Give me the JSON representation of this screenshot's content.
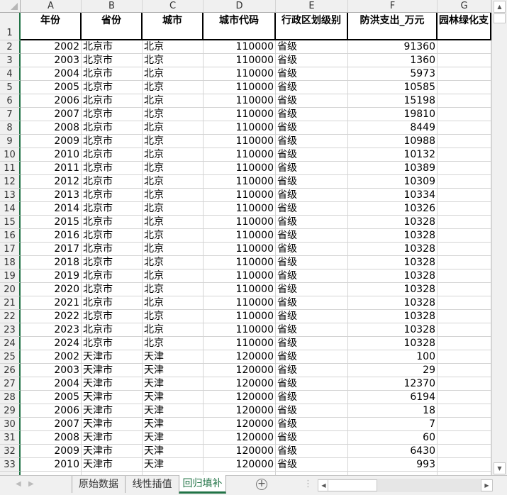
{
  "columns": [
    "A",
    "B",
    "C",
    "D",
    "E",
    "F",
    "G"
  ],
  "headers": [
    "年份",
    "省份",
    "城市",
    "城市代码",
    "行政区划级别",
    "防洪支出_万元",
    "园林绿化支"
  ],
  "rows": [
    [
      "2002",
      "北京市",
      "北京",
      "110000",
      "省级",
      "91360"
    ],
    [
      "2003",
      "北京市",
      "北京",
      "110000",
      "省级",
      "1360"
    ],
    [
      "2004",
      "北京市",
      "北京",
      "110000",
      "省级",
      "5973"
    ],
    [
      "2005",
      "北京市",
      "北京",
      "110000",
      "省级",
      "10585"
    ],
    [
      "2006",
      "北京市",
      "北京",
      "110000",
      "省级",
      "15198"
    ],
    [
      "2007",
      "北京市",
      "北京",
      "110000",
      "省级",
      "19810"
    ],
    [
      "2008",
      "北京市",
      "北京",
      "110000",
      "省级",
      "8449"
    ],
    [
      "2009",
      "北京市",
      "北京",
      "110000",
      "省级",
      "10988"
    ],
    [
      "2010",
      "北京市",
      "北京",
      "110000",
      "省级",
      "10132"
    ],
    [
      "2011",
      "北京市",
      "北京",
      "110000",
      "省级",
      "10389"
    ],
    [
      "2012",
      "北京市",
      "北京",
      "110000",
      "省级",
      "10309"
    ],
    [
      "2013",
      "北京市",
      "北京",
      "110000",
      "省级",
      "10334"
    ],
    [
      "2014",
      "北京市",
      "北京",
      "110000",
      "省级",
      "10326"
    ],
    [
      "2015",
      "北京市",
      "北京",
      "110000",
      "省级",
      "10328"
    ],
    [
      "2016",
      "北京市",
      "北京",
      "110000",
      "省级",
      "10328"
    ],
    [
      "2017",
      "北京市",
      "北京",
      "110000",
      "省级",
      "10328"
    ],
    [
      "2018",
      "北京市",
      "北京",
      "110000",
      "省级",
      "10328"
    ],
    [
      "2019",
      "北京市",
      "北京",
      "110000",
      "省级",
      "10328"
    ],
    [
      "2020",
      "北京市",
      "北京",
      "110000",
      "省级",
      "10328"
    ],
    [
      "2021",
      "北京市",
      "北京",
      "110000",
      "省级",
      "10328"
    ],
    [
      "2022",
      "北京市",
      "北京",
      "110000",
      "省级",
      "10328"
    ],
    [
      "2023",
      "北京市",
      "北京",
      "110000",
      "省级",
      "10328"
    ],
    [
      "2024",
      "北京市",
      "北京",
      "110000",
      "省级",
      "10328"
    ],
    [
      "2002",
      "天津市",
      "天津",
      "120000",
      "省级",
      "100"
    ],
    [
      "2003",
      "天津市",
      "天津",
      "120000",
      "省级",
      "29"
    ],
    [
      "2004",
      "天津市",
      "天津",
      "120000",
      "省级",
      "12370"
    ],
    [
      "2005",
      "天津市",
      "天津",
      "120000",
      "省级",
      "6194"
    ],
    [
      "2006",
      "天津市",
      "天津",
      "120000",
      "省级",
      "18"
    ],
    [
      "2007",
      "天津市",
      "天津",
      "120000",
      "省级",
      "7"
    ],
    [
      "2008",
      "天津市",
      "天津",
      "120000",
      "省级",
      "60"
    ],
    [
      "2009",
      "天津市",
      "天津",
      "120000",
      "省级",
      "6430"
    ],
    [
      "2010",
      "天津市",
      "天津",
      "120000",
      "省级",
      "993"
    ]
  ],
  "sheets": [
    "原始数据",
    "线性插值",
    "回归填补"
  ],
  "active_sheet": "回归填补",
  "accent": "#217346"
}
